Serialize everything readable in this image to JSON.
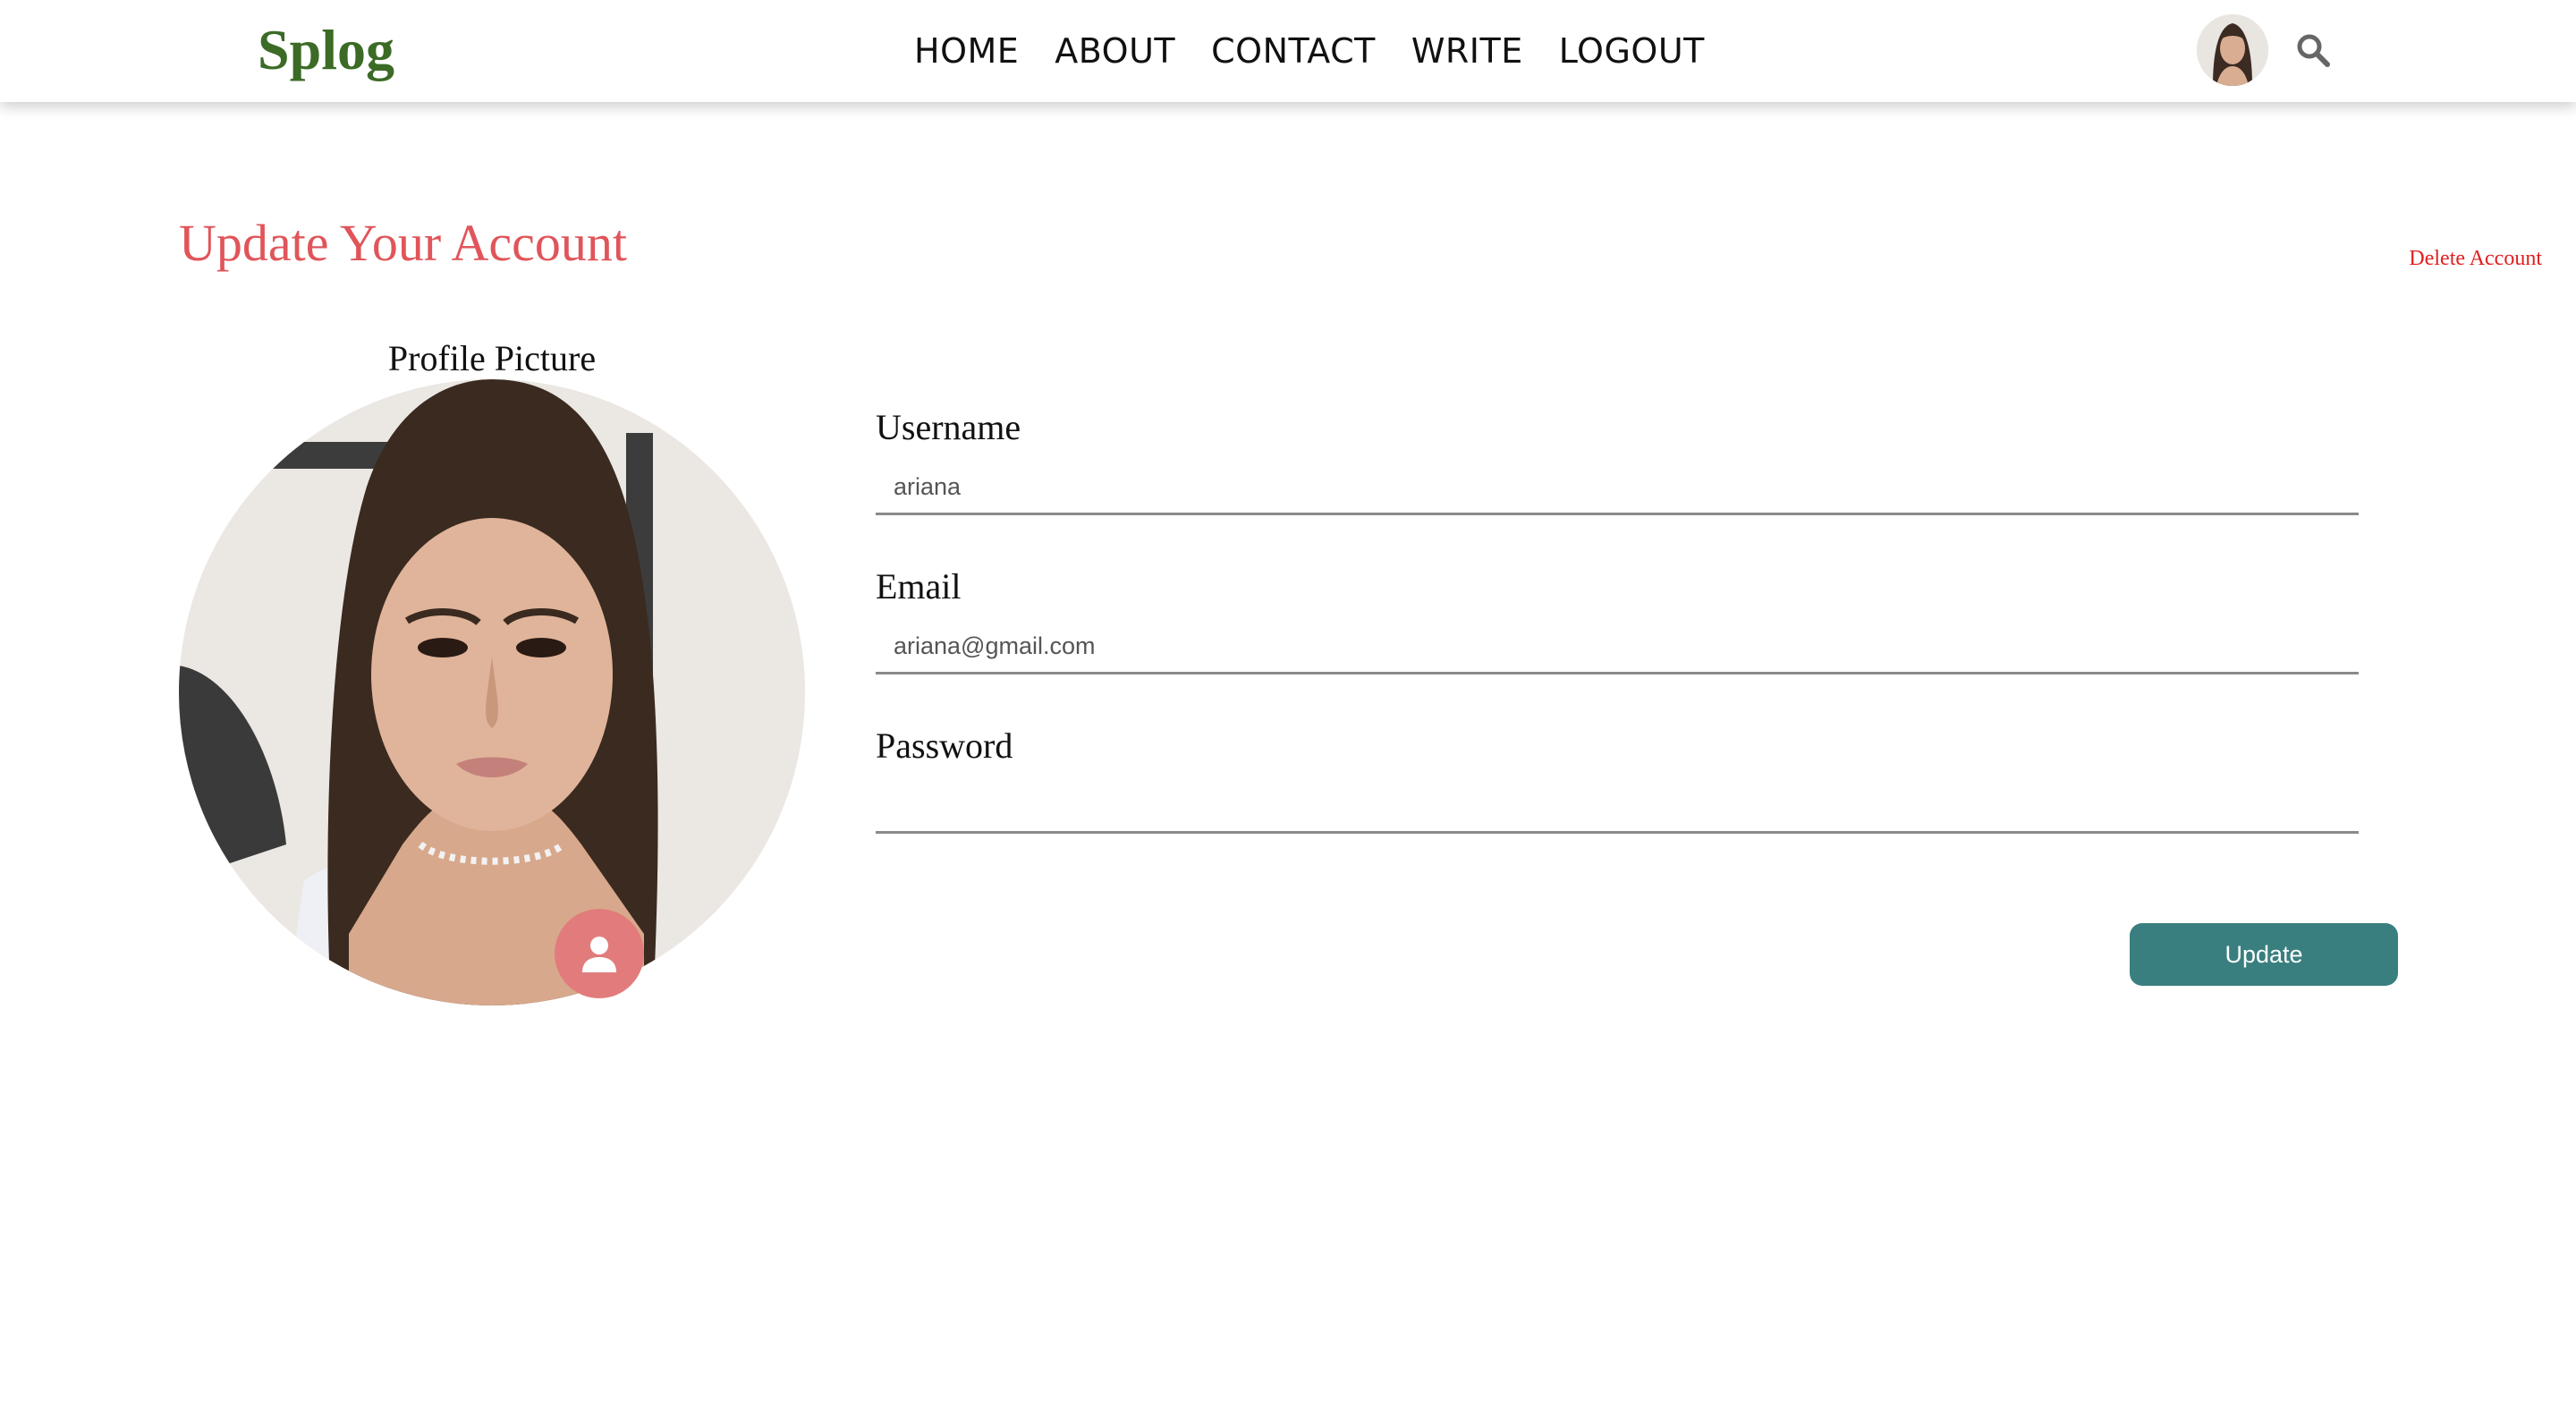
{
  "header": {
    "logo": "Splog",
    "nav": [
      "HOME",
      "ABOUT",
      "CONTACT",
      "WRITE",
      "LOGOUT"
    ],
    "search_icon": "search-icon",
    "avatar_icon": "user-avatar"
  },
  "page": {
    "title": "Update Your Account",
    "delete_label": "Delete Account"
  },
  "profile": {
    "label": "Profile Picture",
    "upload_icon": "user-icon",
    "upload_color": "#e27c7c"
  },
  "form": {
    "username_label": "Username",
    "username_value": "ariana",
    "email_label": "Email",
    "email_value": "ariana@gmail.com",
    "password_label": "Password",
    "password_value": "",
    "update_label": "Update"
  },
  "colors": {
    "logo": "#3b6b26",
    "title": "#e0555a",
    "delete": "#e02020",
    "button": "#3a7f7f"
  }
}
